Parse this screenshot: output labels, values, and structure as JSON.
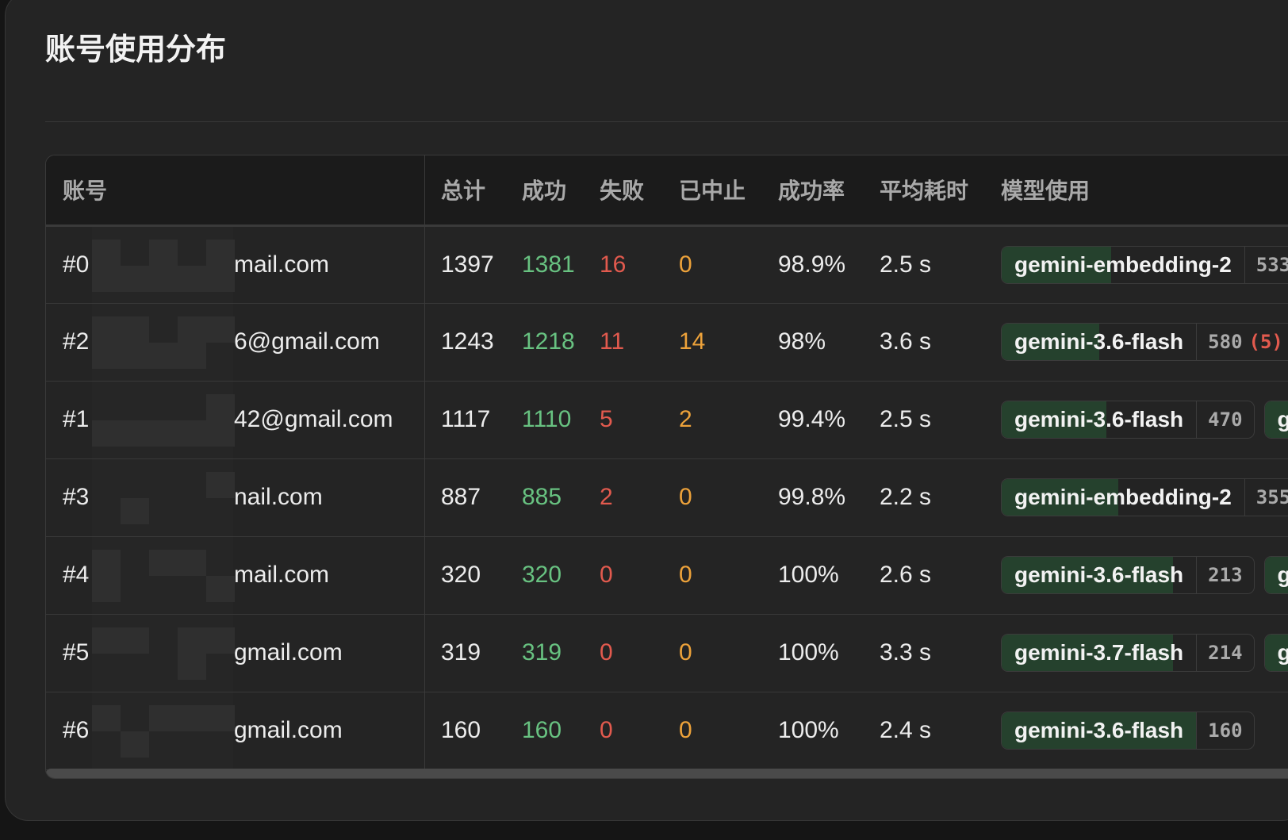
{
  "title": "账号使用分布",
  "columns": {
    "account": "账号",
    "total": "总计",
    "success": "成功",
    "fail": "失败",
    "aborted": "已中止",
    "success_rate": "成功率",
    "avg_time": "平均耗时",
    "model_usage": "模型使用"
  },
  "rows": [
    {
      "num": "#0",
      "email": "mail.com",
      "total": "1397",
      "success": "1381",
      "fail": "16",
      "aborted": "0",
      "rate": "98.9%",
      "avg": "2.5 s",
      "models": [
        {
          "name": "gemini-embedding-2",
          "count": "533",
          "abort": "",
          "fill": 0.45
        }
      ]
    },
    {
      "num": "#2",
      "email": "6@gmail.com",
      "total": "1243",
      "success": "1218",
      "fail": "11",
      "aborted": "14",
      "rate": "98%",
      "avg": "3.6 s",
      "models": [
        {
          "name": "gemini-3.6-flash",
          "count": "580",
          "abort": "(5)",
          "fill": 0.5
        }
      ]
    },
    {
      "num": "#1",
      "email": "42@gmail.com",
      "total": "1117",
      "success": "1110",
      "fail": "5",
      "aborted": "2",
      "rate": "99.4%",
      "avg": "2.5 s",
      "models": [
        {
          "name": "gemini-3.6-flash",
          "count": "470",
          "abort": "",
          "fill": 0.54
        },
        {
          "name": "gen",
          "count": "",
          "abort": "",
          "fill": 1.0
        }
      ]
    },
    {
      "num": "#3",
      "email": "nail.com",
      "total": "887",
      "success": "885",
      "fail": "2",
      "aborted": "0",
      "rate": "99.8%",
      "avg": "2.2 s",
      "models": [
        {
          "name": "gemini-embedding-2",
          "count": "355",
          "abort": "",
          "fill": 0.48
        }
      ]
    },
    {
      "num": "#4",
      "email": "mail.com",
      "total": "320",
      "success": "320",
      "fail": "0",
      "aborted": "0",
      "rate": "100%",
      "avg": "2.6 s",
      "models": [
        {
          "name": "gemini-3.6-flash",
          "count": "213",
          "abort": "",
          "fill": 0.88
        },
        {
          "name": "gen",
          "count": "",
          "abort": "",
          "fill": 1.0
        }
      ]
    },
    {
      "num": "#5",
      "email": "gmail.com",
      "total": "319",
      "success": "319",
      "fail": "0",
      "aborted": "0",
      "rate": "100%",
      "avg": "3.3 s",
      "models": [
        {
          "name": "gemini-3.7-flash",
          "count": "214",
          "abort": "",
          "fill": 0.88
        },
        {
          "name": "gen",
          "count": "",
          "abort": "",
          "fill": 1.0
        }
      ]
    },
    {
      "num": "#6",
      "email": "gmail.com",
      "total": "160",
      "success": "160",
      "fail": "0",
      "aborted": "0",
      "rate": "100%",
      "avg": "2.4 s",
      "models": [
        {
          "name": "gemini-3.6-flash",
          "count": "160",
          "abort": "",
          "fill": 1.0
        }
      ]
    }
  ]
}
